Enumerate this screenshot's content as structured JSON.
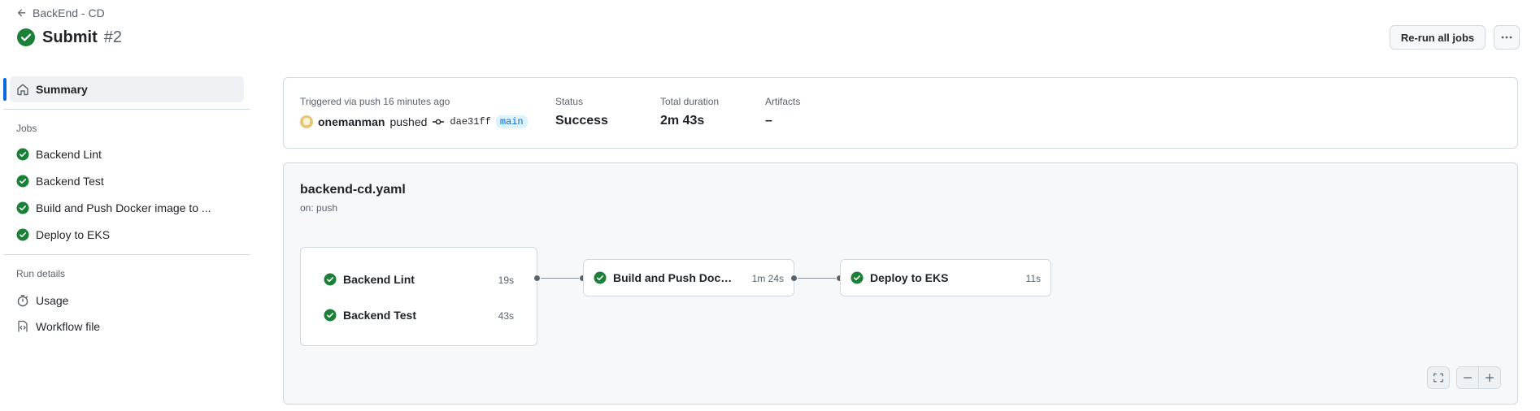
{
  "header": {
    "back_label": "BackEnd - CD",
    "title": "Submit",
    "run_number": "#2",
    "rerun_label": "Re-run all jobs"
  },
  "sidebar": {
    "summary_label": "Summary",
    "jobs_heading": "Jobs",
    "jobs": [
      {
        "label": "Backend Lint",
        "status": "success"
      },
      {
        "label": "Backend Test",
        "status": "success"
      },
      {
        "label": "Build and Push Docker image to ...",
        "status": "success"
      },
      {
        "label": "Deploy to EKS",
        "status": "success"
      }
    ],
    "run_details_heading": "Run details",
    "usage_label": "Usage",
    "workflow_file_label": "Workflow file"
  },
  "summary": {
    "trigger_text": "Triggered via push 16 minutes ago",
    "actor": "onemanman",
    "action": "pushed",
    "commit_sha": "dae31ff",
    "branch": "main",
    "status_label": "Status",
    "status_value": "Success",
    "duration_label": "Total duration",
    "duration_value": "2m 43s",
    "artifacts_label": "Artifacts",
    "artifacts_value": "–"
  },
  "workflow": {
    "file_name": "backend-cd.yaml",
    "trigger": "on: push",
    "jobs": [
      {
        "name": "Backend Lint",
        "duration": "19s",
        "status": "success"
      },
      {
        "name": "Backend Test",
        "duration": "43s",
        "status": "success"
      },
      {
        "name": "Build and Push Docker image to ECR",
        "duration": "1m 24s",
        "status": "success"
      },
      {
        "name": "Deploy to EKS",
        "duration": "11s",
        "status": "success"
      }
    ]
  },
  "colors": {
    "success": "#1a7f37",
    "accent": "#0969da",
    "branch_bg": "#ddf4ff"
  },
  "icons": {
    "back": "arrow-left-icon",
    "status": "check-circle-fill-icon",
    "more": "kebab-horizontal-icon",
    "summary": "home-icon",
    "usage": "stopwatch-icon",
    "workflow_file": "file-code-icon",
    "commit": "git-commit-icon",
    "fullscreen": "screen-full-icon",
    "zoom_out": "minus-icon",
    "zoom_in": "plus-icon"
  }
}
